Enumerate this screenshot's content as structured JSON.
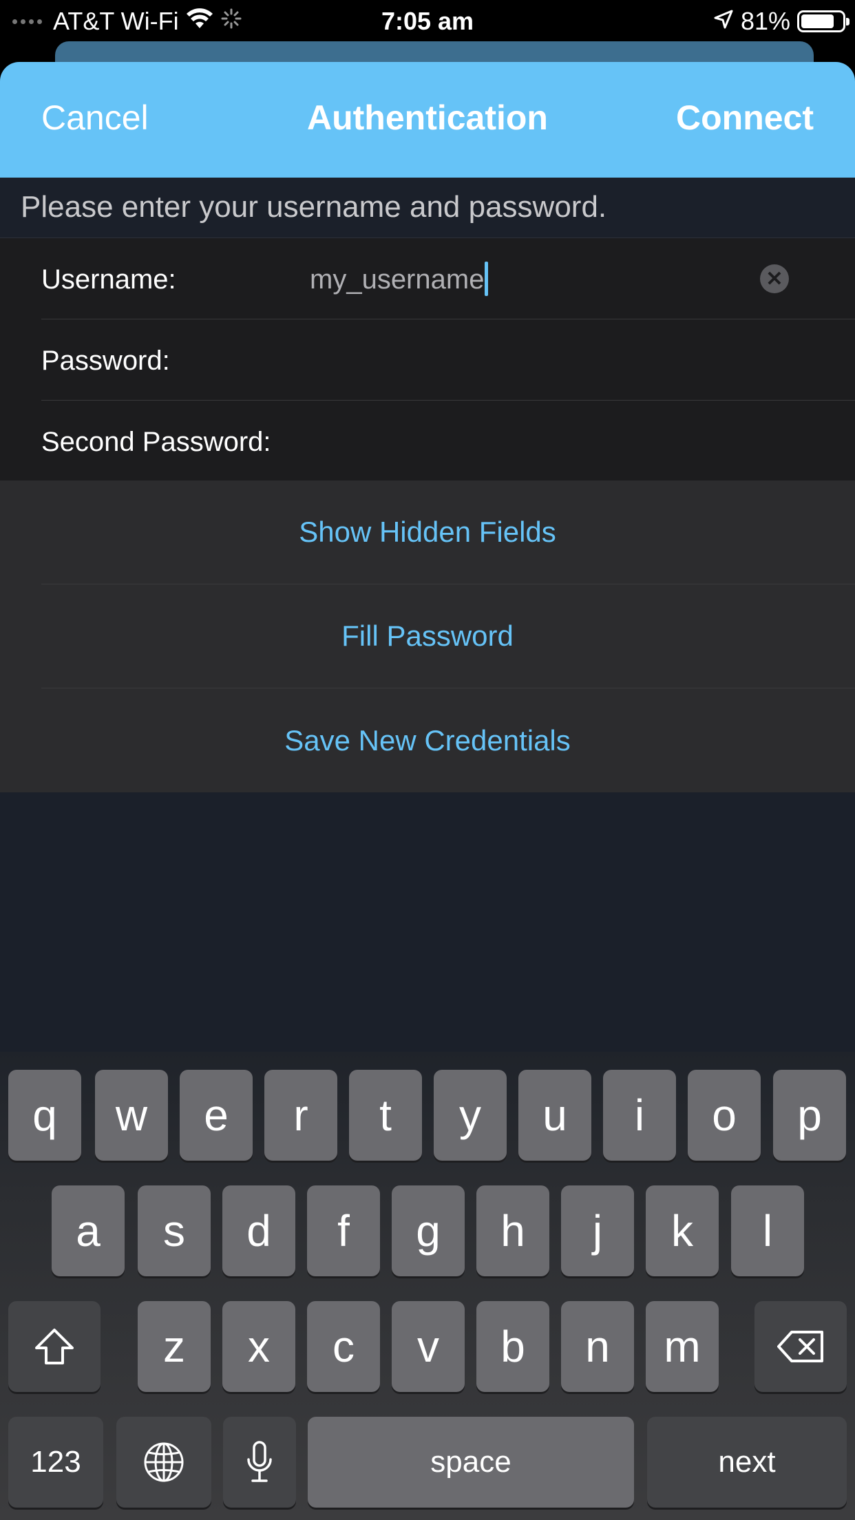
{
  "status_bar": {
    "carrier": "AT&T Wi-Fi",
    "time": "7:05 am",
    "battery_percent": "81%",
    "battery_level": 0.81,
    "icons": [
      "signal-dots-icon",
      "wifi-icon",
      "activity-spinner-icon",
      "location-arrow-icon",
      "battery-icon"
    ]
  },
  "nav": {
    "cancel": "Cancel",
    "title": "Authentication",
    "connect": "Connect"
  },
  "prompt": "Please enter your username and password.",
  "fields": [
    {
      "label": "Username:",
      "value": "my_username"
    },
    {
      "label": "Password:",
      "value": ""
    },
    {
      "label": "Second Password:",
      "value": ""
    }
  ],
  "actions": {
    "show_hidden": "Show Hidden Fields",
    "fill_password": "Fill Password",
    "save_credentials": "Save New Credentials"
  },
  "keyboard": {
    "row1": [
      "q",
      "w",
      "e",
      "r",
      "t",
      "y",
      "u",
      "i",
      "o",
      "p"
    ],
    "row2": [
      "a",
      "s",
      "d",
      "f",
      "g",
      "h",
      "j",
      "k",
      "l"
    ],
    "row3": [
      "z",
      "x",
      "c",
      "v",
      "b",
      "n",
      "m"
    ],
    "numbers": "123",
    "space": "space",
    "next": "next"
  },
  "colors": {
    "accent": "#66c3f7",
    "nav_background": "#66c3f7",
    "background": "#1b202a"
  }
}
